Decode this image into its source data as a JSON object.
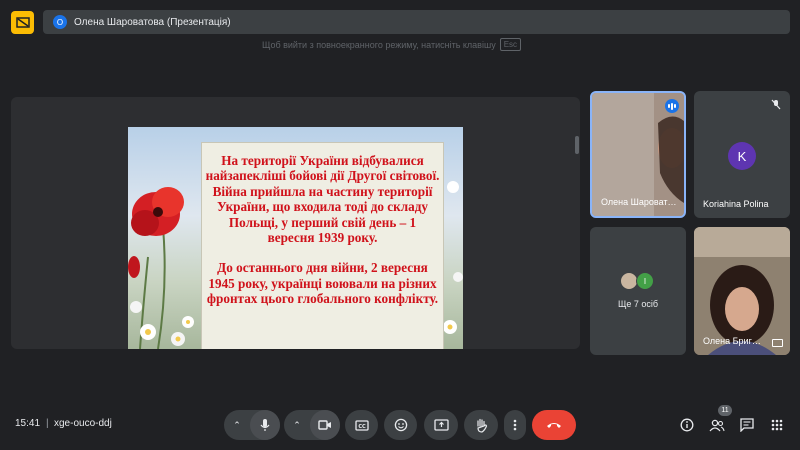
{
  "presentation_bar": {
    "avatar_initial": "О",
    "title": "Олена Шароватова (Презентація)"
  },
  "hint": {
    "text": "Щоб вийти з повноекранного режиму, натисніть клавішу",
    "key": "Esc"
  },
  "slide": {
    "paragraph1": "На території України відбувалися найзапекліші бойові дії Другої світової. Війна прийшла на частину території України, що входила тоді до складу Польщі, у перший свій день – 1 вересня 1939 року.",
    "paragraph2": "До останнього дня війни, 2 вересня 1945 року, українці воювали на різних фронтах цього глобального конфлікту."
  },
  "participants": [
    {
      "name": "Олена Шароват…",
      "speaking": true
    },
    {
      "name": "Koriahina Polina",
      "avatar_initial": "K",
      "muted": true
    },
    {
      "more_label": "Ще 7 осіб",
      "mini_avatar_initial": "I"
    },
    {
      "name": "Олена Бриг…",
      "presenting": true
    }
  ],
  "bottom_bar": {
    "time": "15:41",
    "separator": "|",
    "meeting_code": "xge-ouco-ddj",
    "participant_count": "11"
  },
  "colors": {
    "background": "#202124",
    "control": "#3c4043",
    "hangup": "#ea4335",
    "accent": "#1a73e8",
    "slide_text": "#d0121b",
    "app_icon": "#fbbc04"
  }
}
